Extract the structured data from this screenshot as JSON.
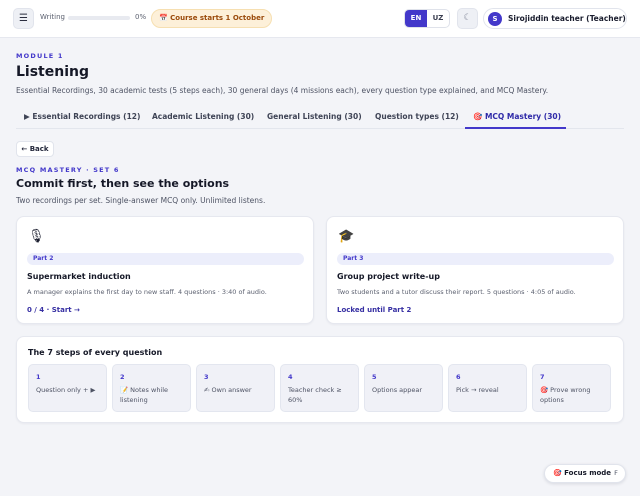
{
  "topbar": {
    "menu_icon": "☰",
    "writing_label": "Writing",
    "writing_progress": 0,
    "writing_progress_label": "0%",
    "course_banner": "📅 Course starts 1 October",
    "languages": [
      "EN",
      "UZ"
    ],
    "active_language": "EN",
    "theme_icon": "☾",
    "user_initial": "S",
    "user_name": "Sirojiddin teacher (Teacher)"
  },
  "module": {
    "label": "MODULE 1",
    "title": "Listening",
    "description": "Essential Recordings, 30 academic tests (5 steps each), 30 general days (4 missions each), every question type explained, and MCQ Mastery."
  },
  "tabs": [
    {
      "label": "▶ Essential Recordings (12)"
    },
    {
      "label": "Academic Listening (30)"
    },
    {
      "label": "General Listening (30)"
    },
    {
      "label": "Question types (12)"
    },
    {
      "label": "🎯 MCQ Mastery (30)"
    }
  ],
  "active_tab": "🎯 MCQ Mastery (30)",
  "back_label": "← Back",
  "set": {
    "label": "MCQ MASTERY · SET 6",
    "title": "Commit first, then see the options",
    "description": "Two recordings per set. Single-answer MCQ only. Unlimited listens."
  },
  "cards": [
    {
      "icon": "🎙",
      "part": "Part 2",
      "title": "Supermarket induction",
      "description": "A manager explains the first day to new staff. 4 questions · 3:40 of audio.",
      "action": "0 / 4 · Start →"
    },
    {
      "icon": "🎓",
      "part": "Part 3",
      "title": "Group project write-up",
      "description": "Two students and a tutor discuss their report. 5 questions · 4:05 of audio.",
      "action": "Locked until Part 2"
    }
  ],
  "steps": {
    "title": "The 7 steps of every question",
    "items": [
      {
        "num": "1",
        "text": "Question only + ▶"
      },
      {
        "num": "2",
        "text": "📝 Notes while listening"
      },
      {
        "num": "3",
        "text": "✍ Own answer"
      },
      {
        "num": "4",
        "text": "Teacher check ≥ 60%"
      },
      {
        "num": "5",
        "text": "Options appear"
      },
      {
        "num": "6",
        "text": "Pick → reveal"
      },
      {
        "num": "7",
        "text": "🎯 Prove wrong options"
      }
    ]
  },
  "focus_mode": {
    "label": "🎯 Focus mode",
    "shortcut": "F"
  },
  "colors": {
    "accent": "#4338ca",
    "banner_bg": "#fdf0d9",
    "banner_text": "#9a4a0b"
  }
}
